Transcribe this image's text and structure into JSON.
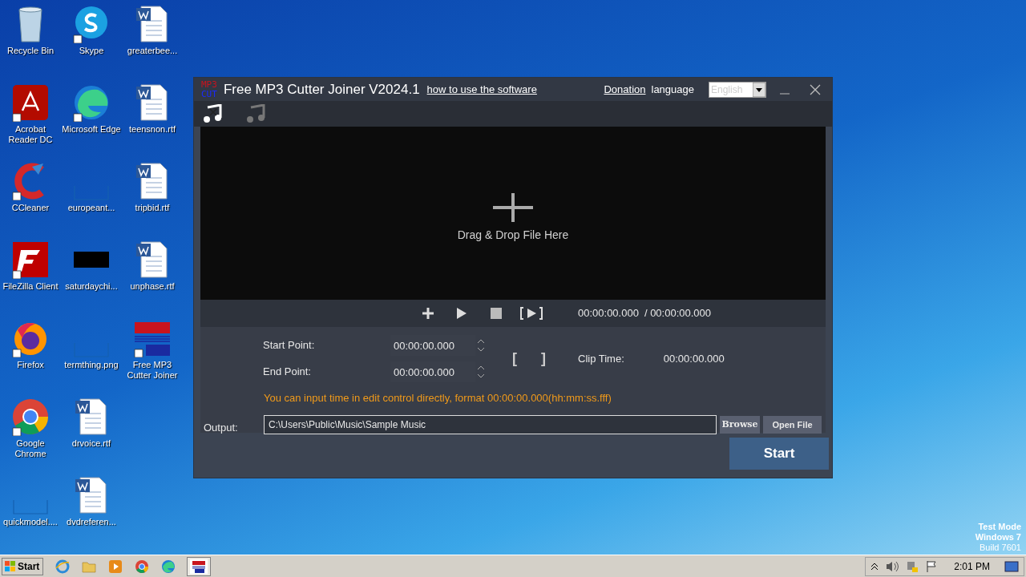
{
  "desktop_icons": [
    {
      "kind": "recycle",
      "label": "Recycle Bin"
    },
    {
      "kind": "acrobat",
      "label": "Acrobat Reader DC"
    },
    {
      "kind": "ccleaner",
      "label": "CCleaner"
    },
    {
      "kind": "filezilla",
      "label": "FileZilla Client"
    },
    {
      "kind": "firefox",
      "label": "Firefox"
    },
    {
      "kind": "chrome",
      "label": "Google Chrome"
    },
    {
      "kind": "blank",
      "label": "quickmodel...."
    },
    {
      "kind": "skype",
      "label": "Skype"
    },
    {
      "kind": "edge",
      "label": "Microsoft Edge"
    },
    {
      "kind": "blank",
      "label": "europeant..."
    },
    {
      "kind": "black",
      "label": "saturdaychi..."
    },
    {
      "kind": "blank",
      "label": "termthing.png"
    },
    {
      "kind": "word",
      "label": "drvoice.rtf"
    },
    {
      "kind": "word",
      "label": "dvdreferen..."
    },
    {
      "kind": "word",
      "label": "greaterbee..."
    },
    {
      "kind": "word",
      "label": "teensnon.rtf"
    },
    {
      "kind": "word",
      "label": "tripbid.rtf"
    },
    {
      "kind": "word",
      "label": "unphase.rtf"
    },
    {
      "kind": "mp3",
      "label": "Free MP3 Cutter Joiner"
    }
  ],
  "window": {
    "logo_top": "MP3",
    "logo_bottom": "CUT",
    "title": "Free MP3 Cutter Joiner V2024.1",
    "help_link": "how to use the software",
    "donation_link": "Donation",
    "language_label": "language",
    "language_value": "English",
    "mode_tabs": [
      {
        "kind": "cut",
        "selected": true
      },
      {
        "kind": "join",
        "selected": false
      }
    ],
    "drop_text": "Drag & Drop File Here",
    "current_time": "00:00:00.000",
    "total_time": "/ 00:00:00.000",
    "start_label": "Start Point:",
    "start_value": "00:00:00.000",
    "end_label": "End Point:",
    "end_value": "00:00:00.000",
    "mark_start": "[",
    "mark_end": "]",
    "clip_label": "Clip Time:",
    "clip_value": "00:00:00.000",
    "hint": "You can input time in edit control directly, format 00:00:00.000(hh:mm:ss.fff)",
    "output_label": "Output:",
    "output_value": "C:\\Users\\Public\\Music\\Sample Music",
    "browse": "Browse",
    "open_file": "Open File",
    "start_button": "Start"
  },
  "watermark_os": [
    "Test Mode",
    "Windows 7",
    "Build 7601"
  ],
  "taskbar": {
    "start": "Start",
    "apps": [
      {
        "kind": "ie",
        "selected": false
      },
      {
        "kind": "folder",
        "selected": false
      },
      {
        "kind": "media",
        "selected": false
      },
      {
        "kind": "chrome",
        "selected": false
      },
      {
        "kind": "edge",
        "selected": false
      },
      {
        "kind": "mp3",
        "selected": true
      }
    ],
    "clock": "2:01 PM"
  }
}
